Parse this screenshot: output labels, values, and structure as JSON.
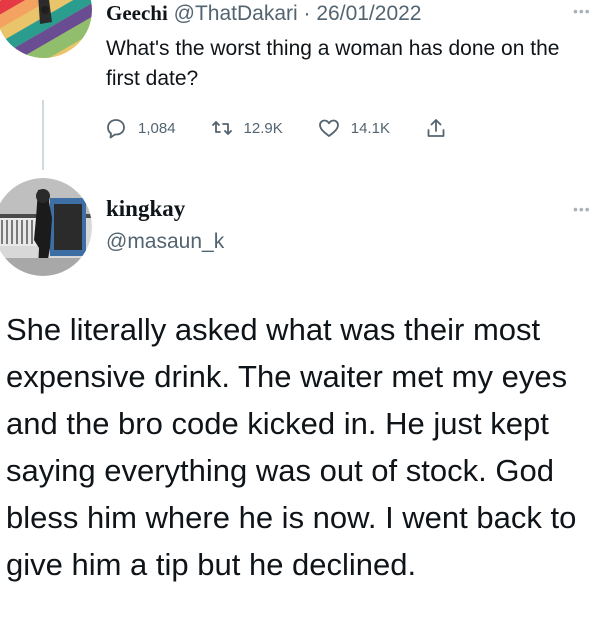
{
  "parent_tweet": {
    "name": "Geechi",
    "handle": "@ThatDakari",
    "separator": "·",
    "date": "26/01/2022",
    "text": "What's the worst thing a woman has done on the first date?",
    "replies_count": "1,084",
    "retweets_count": "12.9K",
    "likes_count": "14.1K",
    "icons": {
      "reply": "reply-icon",
      "retweet": "retweet-icon",
      "like": "heart-icon",
      "share": "share-icon"
    },
    "avatar_colors": [
      "#e63946",
      "#f4a261",
      "#e9c46a",
      "#2a9d8f",
      "#6a4c93",
      "#90be6d"
    ]
  },
  "reply_tweet": {
    "name": "kingkay",
    "handle": "@masaun_k",
    "text": "She literally asked what was their most expensive drink. The waiter met my eyes and the bro code kicked in. He just kept saying everything was out of stock. God bless him where he is now. I went back to give him a tip but he declined."
  },
  "colors": {
    "text_primary": "#0f1419",
    "text_secondary": "#536471",
    "thread_line": "#cfd9de"
  }
}
